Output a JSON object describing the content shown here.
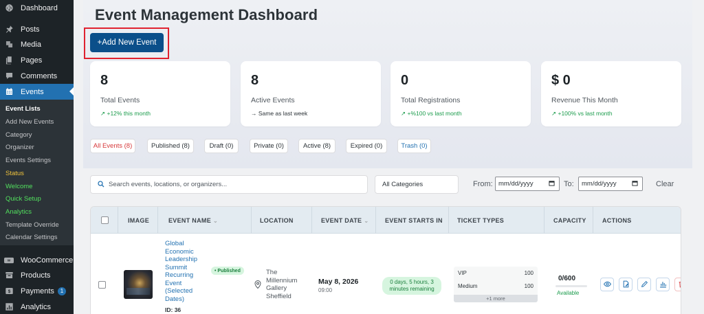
{
  "sidebar": {
    "items": [
      {
        "label": "Dashboard",
        "icon": "dashboard-icon"
      },
      {
        "label": "Posts",
        "icon": "pin-icon"
      },
      {
        "label": "Media",
        "icon": "media-icon"
      },
      {
        "label": "Pages",
        "icon": "pages-icon"
      },
      {
        "label": "Comments",
        "icon": "comments-icon"
      },
      {
        "label": "Events",
        "icon": "calendar-icon"
      }
    ],
    "submenu": [
      {
        "label": "Event Lists"
      },
      {
        "label": "Add New Events"
      },
      {
        "label": "Category"
      },
      {
        "label": "Organizer"
      },
      {
        "label": "Events Settings"
      },
      {
        "label": "Status"
      },
      {
        "label": "Welcome"
      },
      {
        "label": "Quick Setup"
      },
      {
        "label": "Analytics"
      },
      {
        "label": "Template Override"
      },
      {
        "label": "Calendar Settings"
      }
    ],
    "bottom_items": [
      {
        "label": "WooCommerce",
        "icon": "woocommerce-icon"
      },
      {
        "label": "Products",
        "icon": "archive-icon"
      },
      {
        "label": "Payments",
        "icon": "payments-icon",
        "badge": "1"
      },
      {
        "label": "Analytics",
        "icon": "chart-icon"
      }
    ]
  },
  "header": {
    "title": "Event Management Dashboard",
    "add_button": "+Add New Event"
  },
  "stats": [
    {
      "value": "8",
      "label": "Total Events",
      "trend": "↗ +12% this month"
    },
    {
      "value": "8",
      "label": "Active Events",
      "trend": "→ Same as last week"
    },
    {
      "value": "0",
      "label": "Total Registrations",
      "trend": "↗ +%100 vs last month"
    },
    {
      "value": "$ 0",
      "label": "Revenue This Month",
      "trend": "↗ +100% vs last month"
    }
  ],
  "filters": [
    {
      "label": "All Events (8)"
    },
    {
      "label": "Published (8)"
    },
    {
      "label": "Draft (0)"
    },
    {
      "label": "Private (0)"
    },
    {
      "label": "Active (8)"
    },
    {
      "label": "Expired (0)"
    },
    {
      "label": "Trash (0)"
    }
  ],
  "search": {
    "placeholder": "Search events, locations, or organizers...",
    "category": "All Categories",
    "from_label": "From:",
    "to_label": "To:",
    "date_placeholder": "mm/dd/yyyy",
    "clear": "Clear"
  },
  "table": {
    "headers": [
      "IMAGE",
      "EVENT NAME",
      "LOCATION",
      "EVENT DATE",
      "EVENT STARTS IN",
      "TICKET TYPES",
      "CAPACITY",
      "ACTIONS"
    ],
    "rows": [
      {
        "title": "Global Economic Leadership Summit Recurring Event (Selected Dates)",
        "id": "ID: 36",
        "status": "• Published",
        "location": "The Millennium Gallery Sheffield",
        "date": "May 8, 2026",
        "time": "09:00",
        "starts_in": "0 days, 5 hours, 3 minutes remaining",
        "tickets": [
          {
            "name": "VIP",
            "qty": "100"
          },
          {
            "name": "Medium",
            "qty": "100"
          }
        ],
        "more": "+1 more",
        "capacity": "0/600",
        "capacity_status": "Available",
        "capacity_fill": 0
      }
    ]
  },
  "colors": {
    "sidebar_bg": "#1d2327",
    "accent": "#2271b1",
    "primary_button": "#0b4f8a",
    "highlight": "#e0212f",
    "success": "#1a9b4b"
  }
}
